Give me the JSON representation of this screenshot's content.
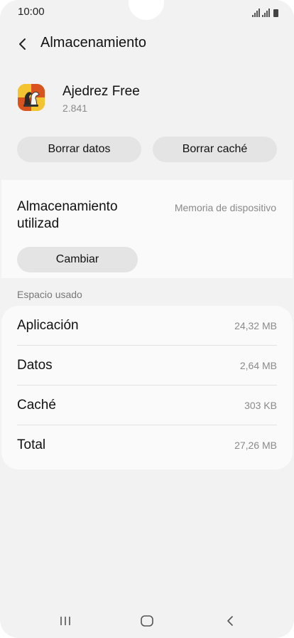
{
  "status_bar": {
    "time": "10:00"
  },
  "header": {
    "title": "Almacenamiento"
  },
  "app": {
    "name": "Ajedrez Free",
    "version": "2.841",
    "icon": "chess-app-icon"
  },
  "actions": {
    "clear_data_label": "Borrar datos",
    "clear_cache_label": "Borrar caché"
  },
  "storage_location": {
    "label": "Almacenamiento utilizad",
    "value": "Memoria de dispositivo",
    "change_label": "Cambiar"
  },
  "space_used": {
    "header": "Espacio usado",
    "rows": [
      {
        "label": "Aplicación",
        "value": "24,32 MB"
      },
      {
        "label": "Datos",
        "value": "2,64 MB"
      },
      {
        "label": "Caché",
        "value": "303 KB"
      },
      {
        "label": "Total",
        "value": "27,26 MB"
      }
    ]
  },
  "navigation": {
    "recent_icon": "recent-apps-icon",
    "home_icon": "home-icon",
    "back_icon": "back-nav-icon"
  }
}
